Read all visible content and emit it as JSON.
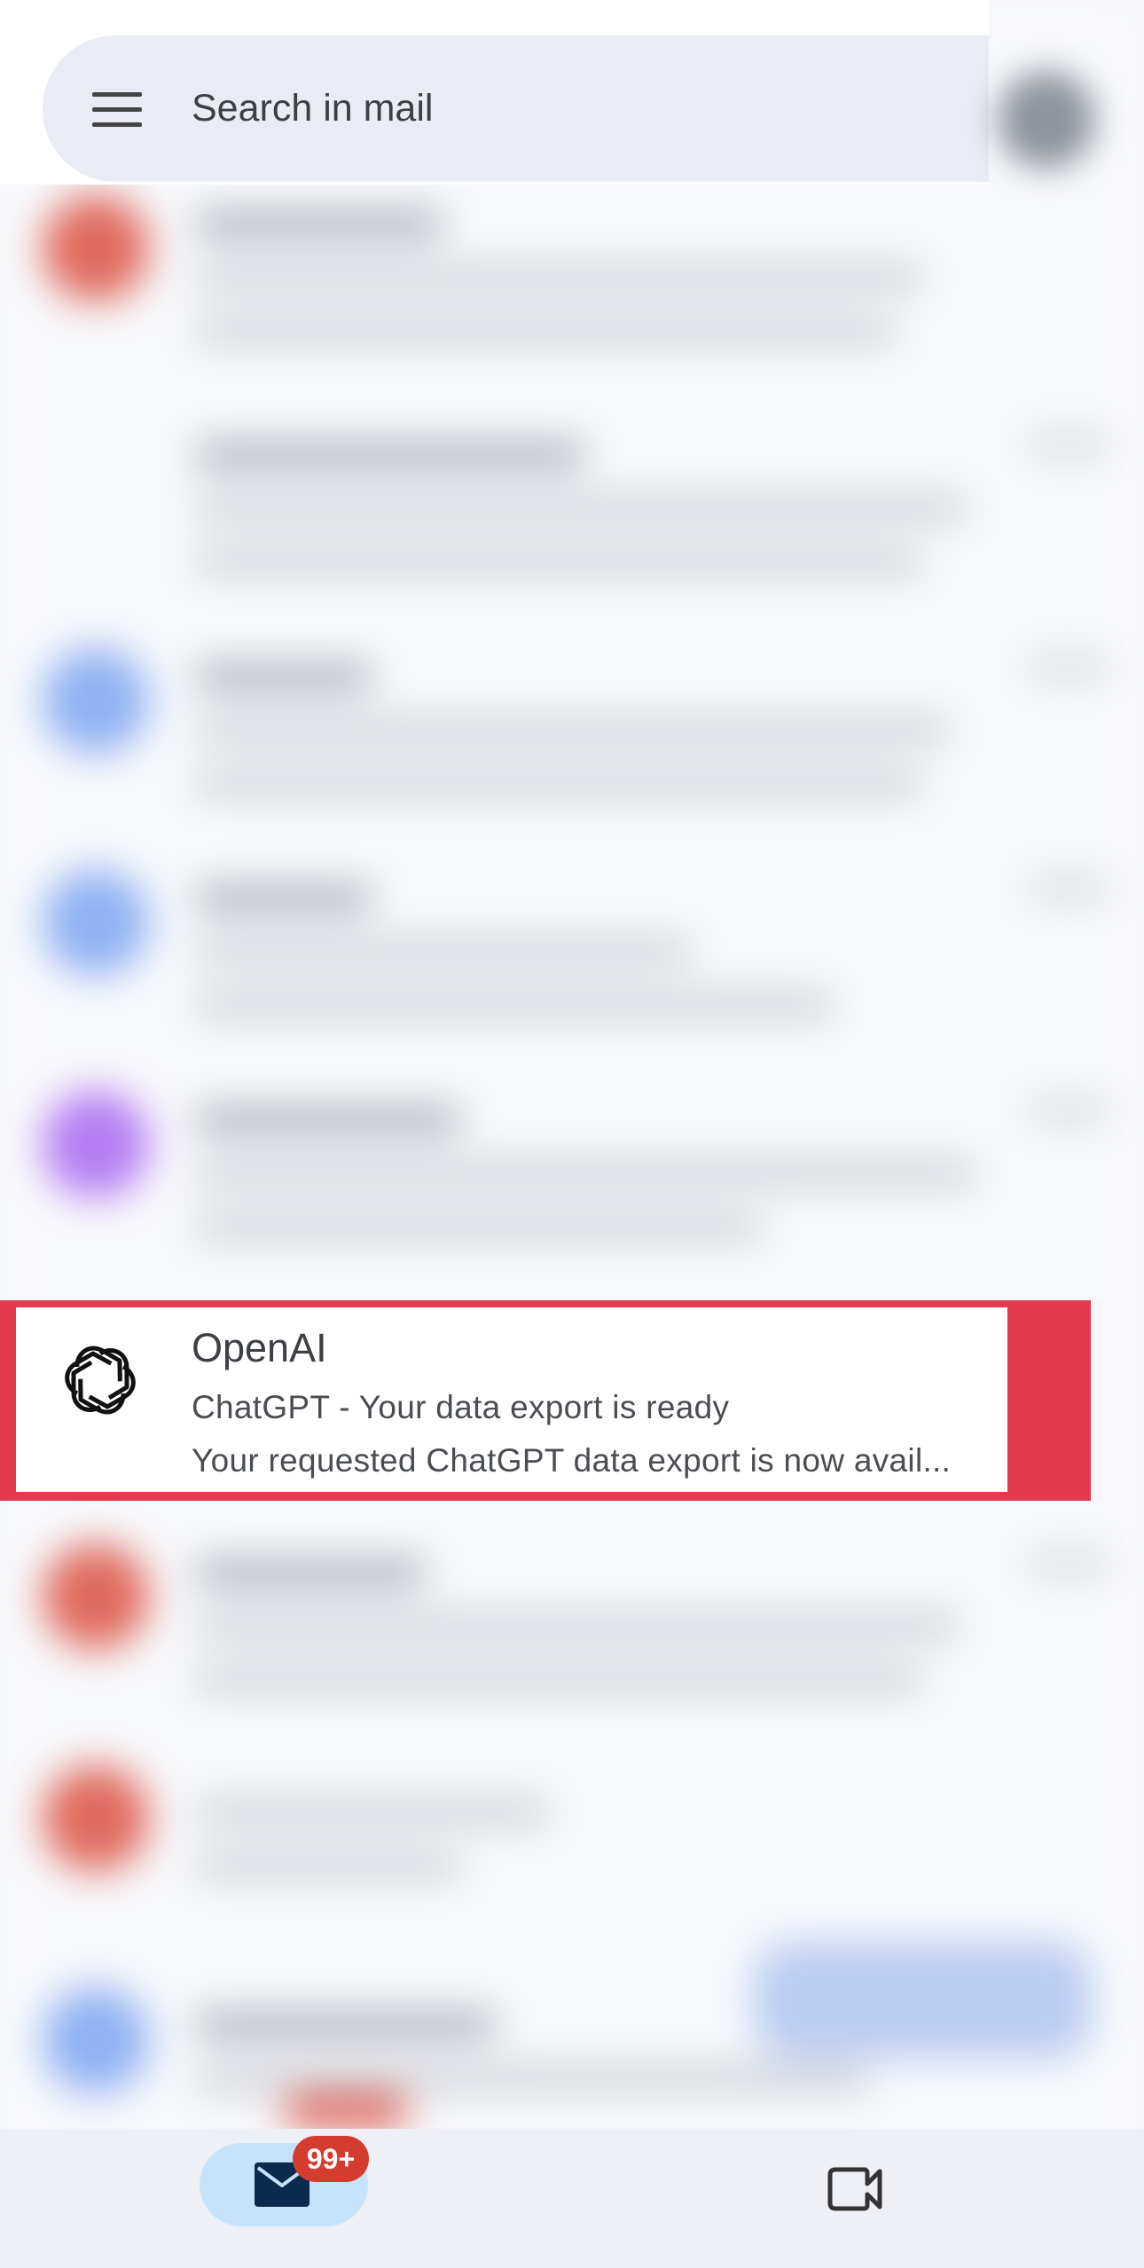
{
  "search": {
    "placeholder": "Search in mail"
  },
  "highlighted_email": {
    "sender": "OpenAI",
    "subject": "ChatGPT - Your data export is ready",
    "snippet": "Your requested ChatGPT data export is now avail..."
  },
  "bottom_nav": {
    "mail_badge": "99+",
    "items": [
      {
        "icon": "mail-icon"
      },
      {
        "icon": "video-camera-icon"
      }
    ]
  },
  "colors": {
    "highlight_border": "#e33a50",
    "badge": "#d43c2f",
    "active_tab": "#c7e3fb",
    "search_bg": "#e9ecf4"
  }
}
